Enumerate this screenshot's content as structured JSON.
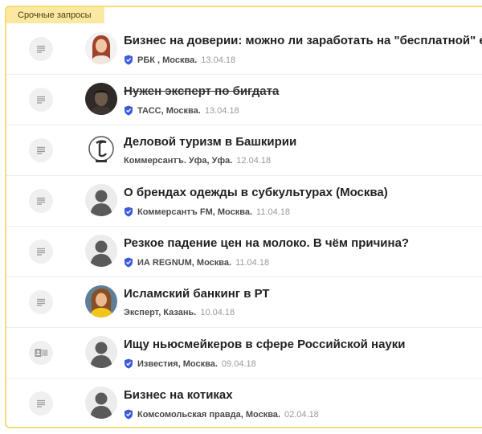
{
  "tag_label": "Срочные запросы",
  "requests": [
    {
      "title": "Бизнес на доверии: можно ли заработать на \"бесплатной\" еде",
      "source": "РБК , Москва.",
      "date": "13.04.18",
      "verified": true,
      "struck": false,
      "avatar": "woman-red-hair",
      "doc_icon": "list"
    },
    {
      "title": "Нужен эксперт по бигдата",
      "source": "ТАСС, Москва.",
      "date": "13.04.18",
      "verified": true,
      "struck": true,
      "avatar": "man-dark",
      "doc_icon": "list"
    },
    {
      "title": "Деловой туризм в Башкирии",
      "source": "Коммерсантъ. Уфа, Уфа.",
      "date": "12.04.18",
      "verified": false,
      "struck": false,
      "avatar": "kommersant-logo",
      "doc_icon": "list"
    },
    {
      "title": "О брендах одежды в субкультурах (Москва)",
      "source": "Коммерсантъ FM, Москва.",
      "date": "11.04.18",
      "verified": true,
      "struck": false,
      "avatar": "placeholder",
      "doc_icon": "list"
    },
    {
      "title": "Резкое падение цен на молоко. В чём причина?",
      "source": "ИА REGNUM, Москва.",
      "date": "11.04.18",
      "verified": true,
      "struck": false,
      "avatar": "placeholder",
      "doc_icon": "list"
    },
    {
      "title": "Исламский банкинг в РТ",
      "source": "Эксперт, Казань.",
      "date": "10.04.18",
      "verified": false,
      "struck": false,
      "avatar": "woman-yellow",
      "doc_icon": "list"
    },
    {
      "title": "Ищу ньюсмейкеров в сфере Российской науки",
      "source": "Известия, Москва.",
      "date": "09.04.18",
      "verified": true,
      "struck": false,
      "avatar": "placeholder",
      "doc_icon": "card"
    },
    {
      "title": "Бизнес на котиках",
      "source": "Комсомольская правда, Москва.",
      "date": "02.04.18",
      "verified": true,
      "struck": false,
      "avatar": "placeholder",
      "doc_icon": "list"
    }
  ],
  "colors": {
    "accent_border": "#f5dc74",
    "tag_bg": "#fce9a1",
    "verified": "#3b5bdb"
  }
}
